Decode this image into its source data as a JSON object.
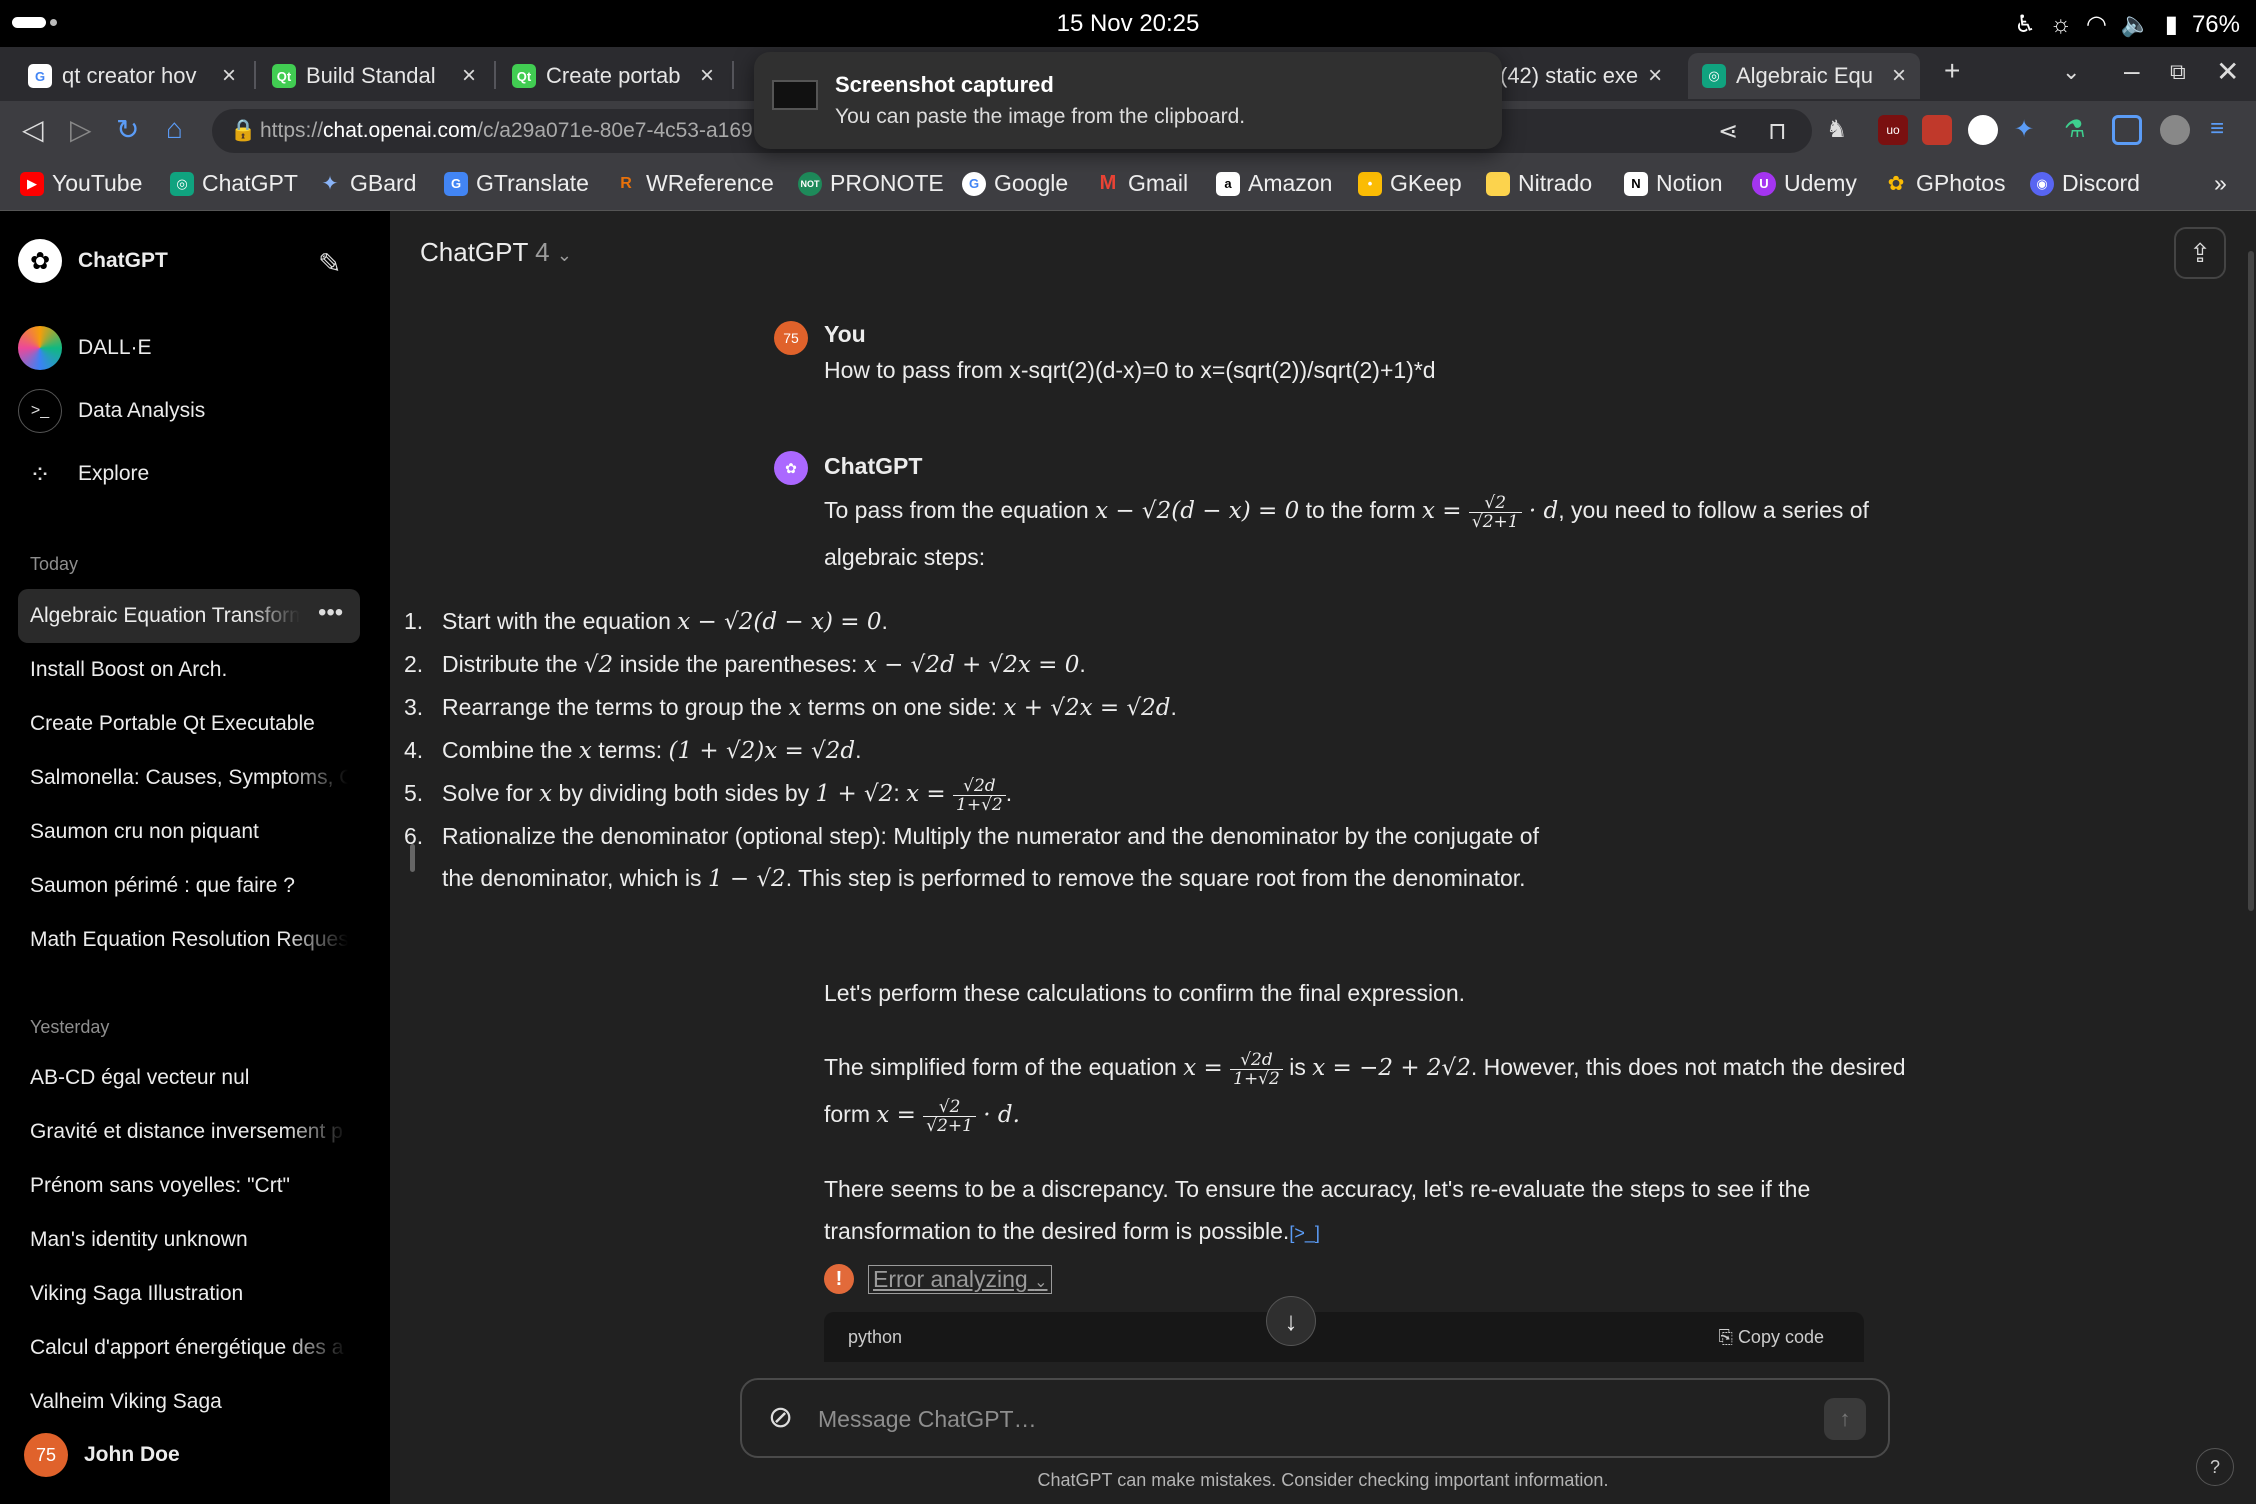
{
  "status": {
    "clock": "15 Nov  20:25",
    "battery": "76%"
  },
  "tabs": [
    {
      "title": "qt creator hov",
      "fav": "G",
      "color": "#ffffff"
    },
    {
      "title": "Build Standal",
      "fav": "Qt",
      "color": "#41cd52"
    },
    {
      "title": "Create portab",
      "fav": "Qt",
      "color": "#41cd52"
    },
    {
      "title": "(42) static exe",
      "fav": "",
      "color": "#888888"
    },
    {
      "title": "Algebraic Equ",
      "fav": "◎",
      "color": "#10a37f"
    }
  ],
  "url": {
    "prefix": "https://",
    "host": "chat.openai.com",
    "path": "/c/a29a071e-80e7-4c53-a169"
  },
  "toast": {
    "title": "Screenshot captured",
    "body": "You can paste the image from the clipboard."
  },
  "bookmarks": [
    "YouTube",
    "ChatGPT",
    "GBard",
    "GTranslate",
    "WReference",
    "PRONOTE",
    "Google",
    "Gmail",
    "Amazon",
    "GKeep",
    "Nitrado",
    "Notion",
    "Udemy",
    "GPhotos",
    "Discord"
  ],
  "sidebar": {
    "brand": "ChatGPT",
    "gpts": [
      "DALL·E",
      "Data Analysis",
      "Explore"
    ],
    "today_label": "Today",
    "today": [
      "Algebraic Equation Transform",
      "Install Boost on Arch.",
      "Create Portable Qt Executable",
      "Salmonella: Causes, Symptoms, C",
      "Saumon cru non piquant",
      "Saumon périmé : que faire ?",
      "Math Equation Resolution Reques"
    ],
    "yesterday_label": "Yesterday",
    "yesterday": [
      "AB-CD égal vecteur nul",
      "Gravité et distance inversement p",
      "Prénom sans voyelles: \"Crt\"",
      "Man's identity unknown",
      "Viking Saga Illustration",
      "Calcul d'apport énergétique des a",
      "Valheim Viking Saga"
    ],
    "user": {
      "initials": "75",
      "name": "John Doe"
    }
  },
  "chat": {
    "model_name": "ChatGPT",
    "model_version": "4",
    "user_label": "You",
    "user_initials": "75",
    "user_message": "How to pass from x-sqrt(2)(d-x)=0 to x=(sqrt(2))/sqrt(2)+1)*d",
    "bot_label": "ChatGPT",
    "intro_a": "To pass from the equation",
    "intro_b": "to the form",
    "intro_c": ", you need to follow a series of algebraic steps:",
    "steps": [
      {
        "n": "1.",
        "a": "Start with the equation",
        "b": "."
      },
      {
        "n": "2.",
        "a": "Distribute the",
        "b": "inside the parentheses:",
        "c": "."
      },
      {
        "n": "3.",
        "a": "Rearrange the terms to group the",
        "b": "terms on one side:",
        "c": "."
      },
      {
        "n": "4.",
        "a": "Combine the",
        "b": "terms:",
        "c": "."
      },
      {
        "n": "5.",
        "a": "Solve for",
        "b": "by dividing both sides by",
        "c": ":",
        "d": "."
      },
      {
        "n": "6.",
        "a": "Rationalize the denominator (optional step): Multiply the numerator and the denominator by the conjugate of the denominator, which is",
        "b": ". This step is performed to remove the square root from the denominator."
      }
    ],
    "para1": "Let's perform these calculations to confirm the final expression.",
    "para2_a": "The simplified form of the equation",
    "para2_b": "is",
    "para2_c": ". However, this does not match the desired form",
    "para3": "There seems to be a discrepancy. To ensure the accuracy, let's re-evaluate the steps to see if the transformation to the desired form is possible.",
    "cite": "[>_]",
    "error": "Error analyzing",
    "code_lang": "python",
    "copy_code": "Copy code"
  },
  "composer": {
    "placeholder": "Message ChatGPT…"
  },
  "footer": "ChatGPT can make mistakes. Consider checking important information."
}
